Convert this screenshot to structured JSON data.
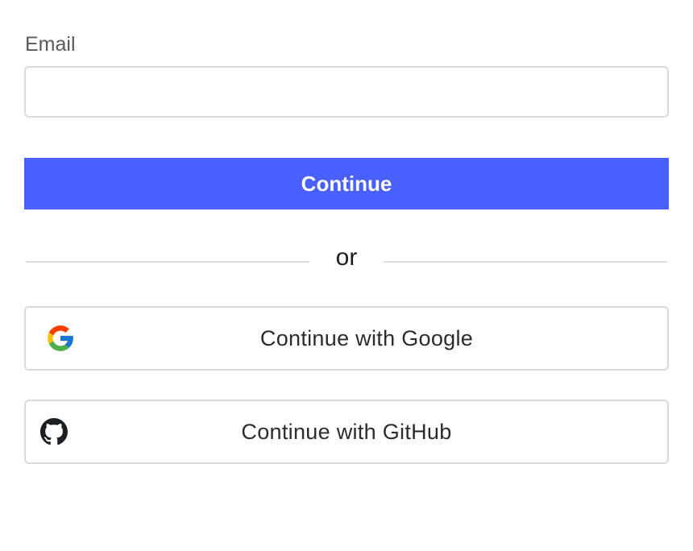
{
  "form": {
    "email_label": "Email",
    "email_value": "",
    "email_placeholder": "",
    "continue_label": "Continue"
  },
  "divider": {
    "text": "or"
  },
  "oauth": {
    "google": {
      "label": "Continue with Google",
      "icon": "google-icon"
    },
    "github": {
      "label": "Continue with GitHub",
      "icon": "github-icon"
    }
  },
  "colors": {
    "primary": "#4a60fe",
    "border": "#d9d9de",
    "text": "#2c2c2e"
  }
}
